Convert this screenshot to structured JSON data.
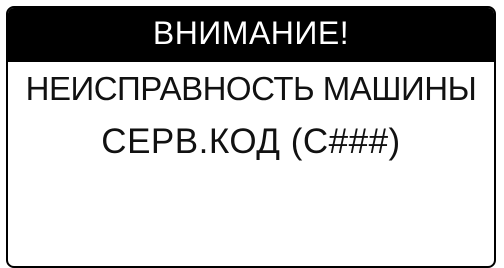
{
  "dialog": {
    "title": "ВНИМАНИЕ!",
    "message": "НЕИСПРАВНОСТЬ МАШИНЫ",
    "service_code": "СЕРВ.КОД (С###)"
  },
  "colors": {
    "header_bg": "#000000",
    "header_text": "#ffffff",
    "body_text": "#111111",
    "border": "#000000"
  }
}
